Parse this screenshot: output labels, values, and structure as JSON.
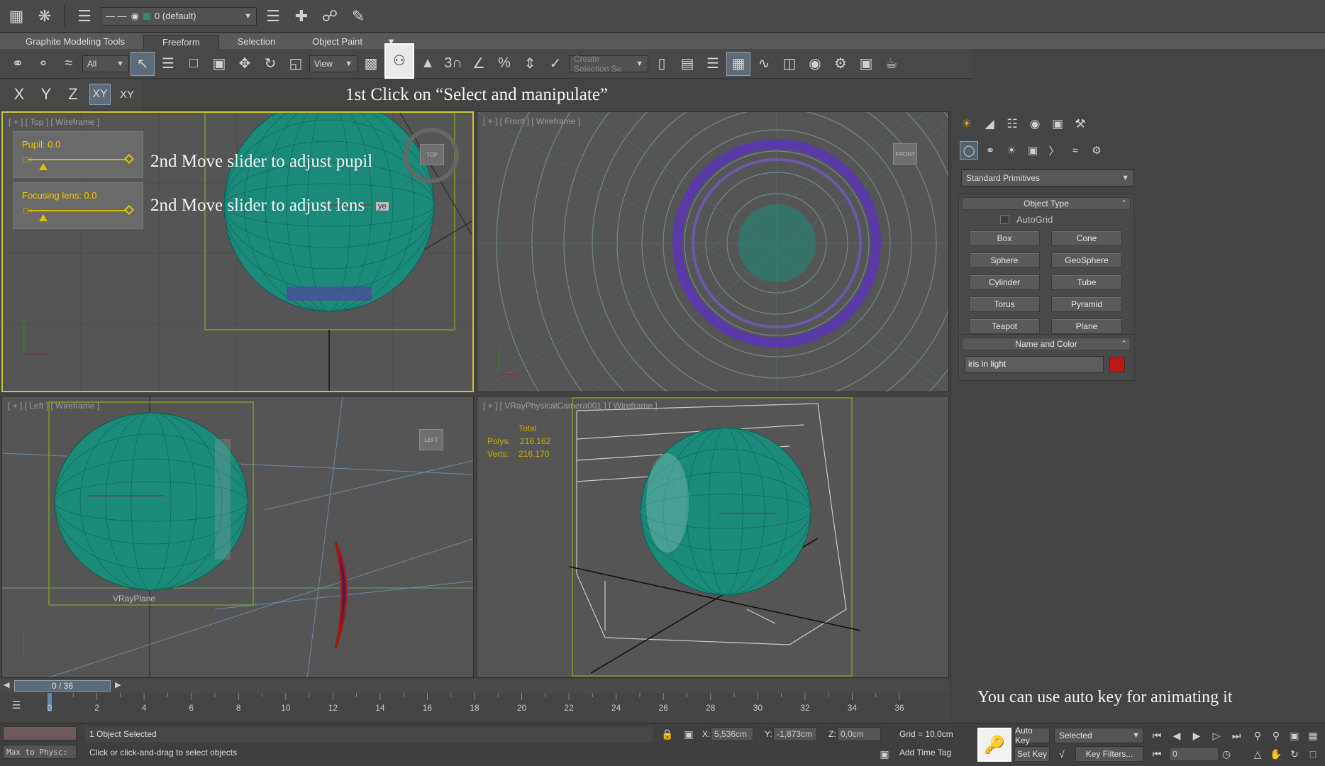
{
  "topbar": {
    "layer_name": "0 (default)",
    "icons": [
      "app-logo-icon",
      "workspace-icon",
      "layer-manager-icon",
      "line-style-icon",
      "visibility-icon",
      "layer-properties-icon",
      "add-layer-icon",
      "select-in-layer-icon",
      "freeze-layer-icon"
    ]
  },
  "ribbon": {
    "tabs": [
      {
        "label": "Graphite Modeling Tools",
        "active": false
      },
      {
        "label": "Freeform",
        "active": true
      },
      {
        "label": "Selection",
        "active": false
      },
      {
        "label": "Object Paint",
        "active": false
      }
    ]
  },
  "toolbar": {
    "filter_value": "All",
    "refcoord_value": "View",
    "named_selection_placeholder": "Create Selection Se",
    "snap_label": "3"
  },
  "axis": {
    "x": "X",
    "y": "Y",
    "z": "Z",
    "xy": "XY",
    "xy_lock": "XY"
  },
  "annotations": {
    "step1": "1st Click on “Select and manipulate”",
    "step2a": "2nd Move slider to adjust pupil",
    "step2b": "2nd Move slider to adjust lens",
    "autokey": "You can use auto key for animating it"
  },
  "viewports": {
    "top": {
      "label": "[ + ] [ Top ] [ Wireframe ]",
      "cube": "TOP",
      "manipulators": [
        {
          "label": "Pupil: 0.0",
          "value": 0.0
        },
        {
          "label": "Focusing lens: 0.0",
          "value": 0.0
        }
      ],
      "obj_tag": "ye"
    },
    "front": {
      "label": "[ + ] [ Front ] [ Wireframe ]",
      "cube": "FRONT"
    },
    "left": {
      "label": "[ + ] [ Left ] [ Wireframe ]",
      "cube": "LEFT",
      "plane_label": "VRayPlane"
    },
    "camera": {
      "label": "[ + ] [ VRayPhysicalCamera001 ] [ Wireframe ]",
      "stats_total": "Total",
      "stats_polys_label": "Polys:",
      "stats_polys": "216.162",
      "stats_verts_label": "Verts:",
      "stats_verts": "216.170"
    }
  },
  "command_panel": {
    "primitive_type": "Standard Primitives",
    "object_type_title": "Object Type",
    "autogrid_label": "AutoGrid",
    "buttons": [
      "Box",
      "Cone",
      "Sphere",
      "GeoSphere",
      "Cylinder",
      "Tube",
      "Torus",
      "Pyramid",
      "Teapot",
      "Plane"
    ],
    "name_color_title": "Name and Color",
    "object_name": "iris in light",
    "object_color": "#c01818"
  },
  "timeline": {
    "frame_display": "0 / 36",
    "ticks": [
      "0",
      "2",
      "4",
      "6",
      "8",
      "10",
      "12",
      "14",
      "16",
      "18",
      "20",
      "22",
      "24",
      "26",
      "28",
      "30",
      "32",
      "34",
      "36"
    ]
  },
  "status": {
    "maxscript": "Max to Physc:",
    "selection": "1 Object Selected",
    "prompt": "Click or click-and-drag to select objects",
    "x_label": "X:",
    "x_value": "5,536cm",
    "y_label": "Y:",
    "y_value": "-1,873cm",
    "z_label": "Z:",
    "z_value": "0,0cm",
    "grid": "Grid = 10,0cm",
    "add_time_tag": "Add Time Tag",
    "auto_key": "Auto Key",
    "set_key": "Set Key",
    "key_mode": "Selected",
    "key_filters": "Key Filters...",
    "current_frame": "0"
  },
  "colors": {
    "mesh": "#1b8a78",
    "iris": "#5a3aa8",
    "active_border": "#c8c23a",
    "manip": "#e0c000"
  }
}
